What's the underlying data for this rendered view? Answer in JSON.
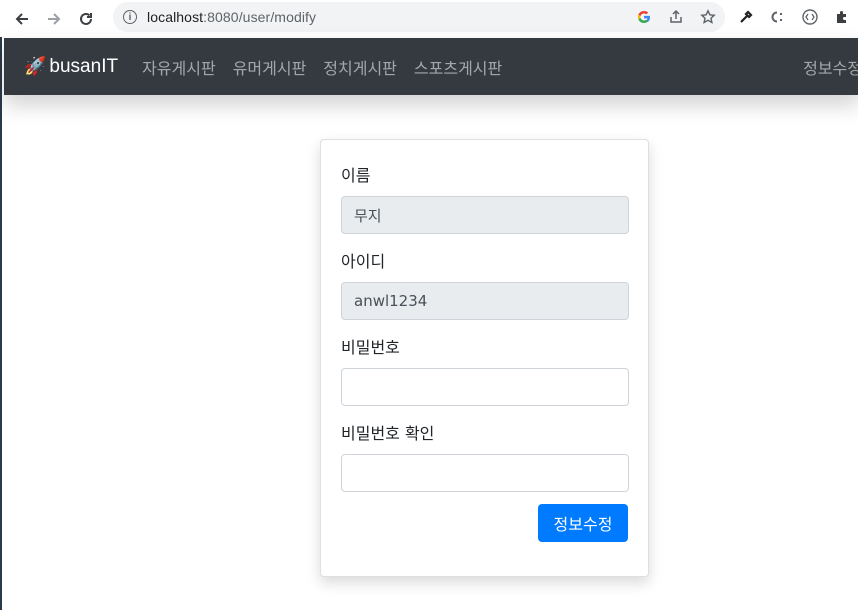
{
  "browser": {
    "url_host": "localhost",
    "url_rest": ":8080/user/modify",
    "icons": [
      "back-arrow-icon",
      "forward-arrow-icon",
      "reload-icon",
      "info-icon",
      "google-icon",
      "share-icon",
      "star-icon",
      "eyedropper-icon",
      "extension-c-icon",
      "extension-brackets-icon",
      "puzzle-icon"
    ]
  },
  "navbar": {
    "brand": "busanIT",
    "brand_icon": "🚀",
    "links": [
      "자유게시판",
      "유머게시판",
      "정치게시판",
      "스포츠게시판"
    ],
    "right_link": "정보수정"
  },
  "form": {
    "name_label": "이름",
    "name_value": "무지",
    "id_label": "아이디",
    "id_value": "anwl1234",
    "password_label": "비밀번호",
    "password_value": "",
    "password_confirm_label": "비밀번호 확인",
    "password_confirm_value": "",
    "submit_label": "정보수정"
  },
  "colors": {
    "navbar_bg": "#343a40",
    "primary": "#007bff",
    "readonly_bg": "#e9ecef"
  }
}
